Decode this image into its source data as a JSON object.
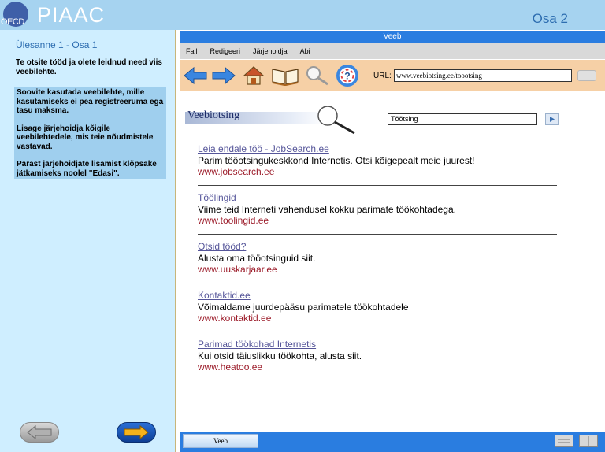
{
  "header": {
    "logo_small": "OECD",
    "logo_main": "PIAAC",
    "section": "Osa 2"
  },
  "task": {
    "title": "Ülesanne 1 - Osa 1",
    "intro": "Te otsite tööd ja olete leidnud need viis veebilehte.",
    "instructions": [
      "Soovite kasutada veebilehte, mille kasutamiseks ei pea registreeruma ega tasu maksma.",
      "Lisage järjehoidja kõigile veebilehtedele, mis teie nõudmistele vastavad.",
      "Pärast järjehoidjate lisamist klõpsake jätkamiseks noolel \"Edasi\"."
    ]
  },
  "browser": {
    "title": "Veeb",
    "menu": [
      "Fail",
      "Redigeeri",
      "Järjehoidja",
      "Abi"
    ],
    "url_label": "URL:",
    "url_value": "www.veebiotsing.ee/toootsing",
    "icons": [
      "back-arrow-icon",
      "forward-arrow-icon",
      "home-icon",
      "bookmark-book-icon",
      "search-magnifier-icon",
      "help-icon"
    ]
  },
  "search": {
    "banner": "Veebiotsing",
    "query": "Töötsing"
  },
  "results": [
    {
      "title": "Leia endale töö - JobSearch.ee",
      "desc": "Parim tööotsingukeskkond Internetis. Otsi kõigepealt meie juurest!",
      "url": "www.jobsearch.ee"
    },
    {
      "title": "Töölingid",
      "desc": "Viime teid Interneti vahendusel kokku parimate töökohtadega.",
      "url": "www.toolingid.ee"
    },
    {
      "title": "Otsid tööd?",
      "desc": "Alusta oma tööotsinguid siit.",
      "url": "www.uuskarjaar.ee"
    },
    {
      "title": "Kontaktid.ee",
      "desc": "Võimaldame juurdepääsu parimatele töökohtadele",
      "url": "www.kontaktid.ee"
    },
    {
      "title": "Parimad töökohad Internetis",
      "desc": "Kui otsid täiuslikku töökohta, alusta siit.",
      "url": "www.heatoo.ee"
    }
  ],
  "statusbar": {
    "tab_label": "Veeb"
  }
}
